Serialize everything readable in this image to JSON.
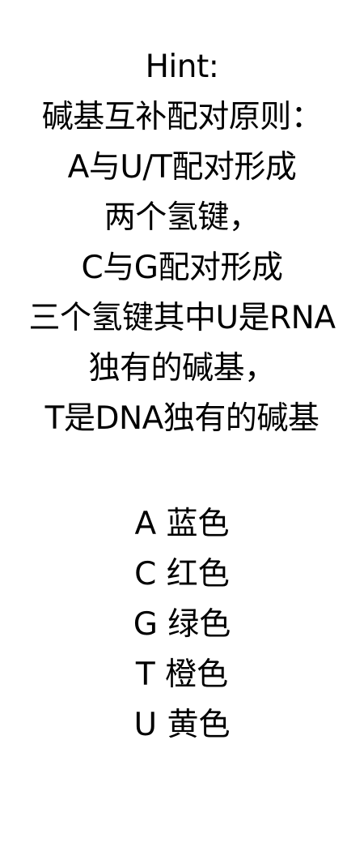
{
  "hint": {
    "lines": [
      "Hint:",
      "碱基互补配对原则：",
      "A与U/T配对形成",
      "两个氢键，",
      "C与G配对形成",
      "三个氢键其中U是RNA",
      "独有的碱基，",
      "T是DNA独有的碱基"
    ]
  },
  "legend": {
    "items": [
      "A 蓝色",
      "C 红色",
      "G 绿色",
      "T 橙色",
      "U 黄色"
    ]
  }
}
